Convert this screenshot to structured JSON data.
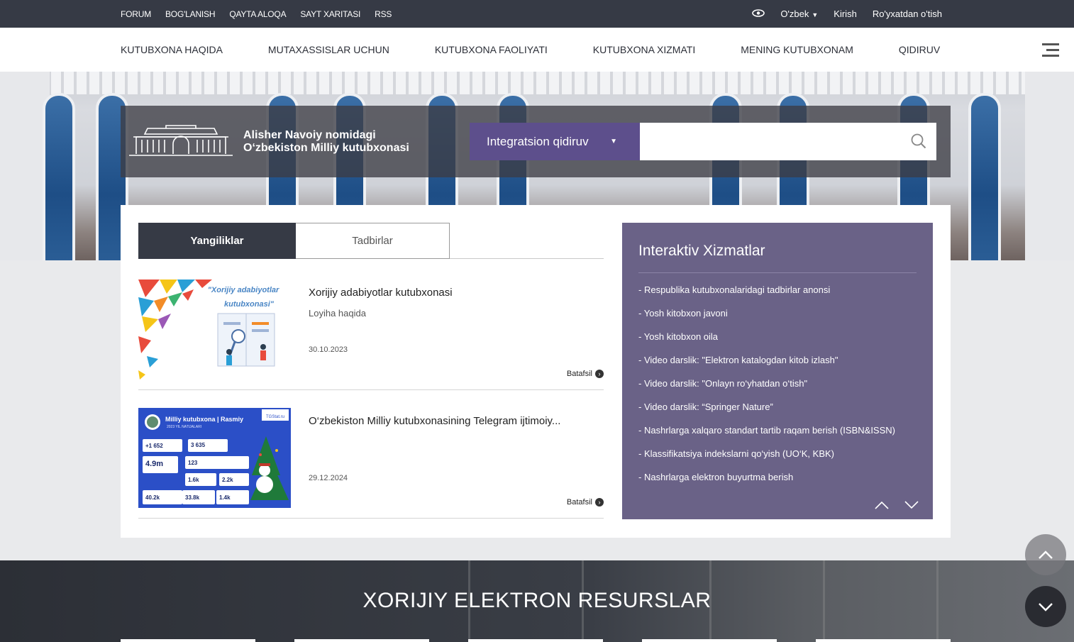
{
  "topbar": {
    "links": [
      "FORUM",
      "BOG'LANISH",
      "QAYTA ALOQA",
      "SAYT XARITASI",
      "RSS"
    ],
    "language": "O'zbek",
    "login": "Kirish",
    "register": "Ro'yxatdan o'tish"
  },
  "nav": {
    "items": [
      "KUTUBXONA HAQIDA",
      "MUTAXASSISLAR UCHUN",
      "KUTUBXONA FAOLIYATI",
      "KUTUBXONA XIZMATI",
      "MENING KUTUBXONAM",
      "QIDIRUV"
    ]
  },
  "brand": {
    "line1": "Alisher Navoiy nomidagi",
    "line2": "O‘zbekiston Milliy kutubxonasi"
  },
  "search": {
    "type_label": "Integratsion qidiruv",
    "value": ""
  },
  "tabs": {
    "news": "Yangiliklar",
    "events": "Tadbirlar"
  },
  "news": [
    {
      "title": "Xorijiy adabiyotlar kutubxonasi",
      "subtitle": "Loyiha haqida",
      "date": "30.10.2023",
      "more": "Batafsil",
      "thumb_text1": "\"Xorijiy adabiyotlar",
      "thumb_text2": "kutubxonasi\""
    },
    {
      "title": "O‘zbekiston Milliy kutubxonasining Telegram ijtimoiy...",
      "subtitle": "",
      "date": "29.12.2024",
      "more": "Batafsil",
      "thumb_heading": "Milliy kutubxona | Rasmiy",
      "thumb_sub": "2023 YIL NATIJALARI",
      "thumb_badge": "TGStat.ru",
      "thumb_stats": [
        "+1 652",
        "3 635",
        "4.9m",
        "123",
        "1.6k",
        "2.2k",
        "40.2k",
        "33.8k",
        "1.4k"
      ]
    }
  ],
  "interactive": {
    "title": "Interaktiv Xizmatlar",
    "items": [
      "Respublika kutubxonalaridagi tadbirlar anonsi",
      "Yosh kitobxon javoni",
      "Yosh kitobxon oila",
      "Video darslik: \"Elektron katalogdan kitob izlash\"",
      "Video darslik: \"Onlayn ro‘yhatdan o‘tish\"",
      "Video darslik: “Springer Nature”",
      "Nashrlarga xalqaro standart tartib raqam berish (ISBN&ISSN)",
      "Klassifikatsiya indekslarni qo‘yish (UO‘K, KBK)",
      "Nashrlarga elektron buyurtma berish"
    ]
  },
  "resources": {
    "title": "XORIJIY ELEKTRON RESURSLAR"
  },
  "colors": {
    "topbar": "#363a45",
    "accent_purple": "#5d4f8c",
    "panel_purple": "#6a6287"
  }
}
